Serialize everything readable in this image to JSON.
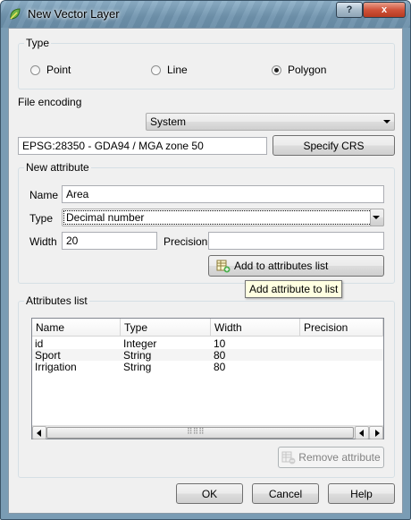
{
  "window": {
    "title": "New Vector Layer",
    "help_glyph": "?",
    "close_glyph": "x"
  },
  "type_group": {
    "title": "Type",
    "options": [
      {
        "label": "Point",
        "checked": false
      },
      {
        "label": "Line",
        "checked": false
      },
      {
        "label": "Polygon",
        "checked": true
      }
    ]
  },
  "encoding": {
    "label": "File encoding",
    "value": "System"
  },
  "crs": {
    "value": "EPSG:28350 - GDA94 / MGA zone 50",
    "button_label": "Specify CRS"
  },
  "new_attribute": {
    "title": "New attribute",
    "name_label": "Name",
    "name_value": "Area",
    "type_label": "Type",
    "type_value": "Decimal number",
    "width_label": "Width",
    "width_value": "20",
    "precision_label": "Precision",
    "precision_value": "",
    "add_button_label": "Add to attributes list",
    "tooltip": "Add attribute to list"
  },
  "attributes_list": {
    "title": "Attributes list",
    "columns": [
      "Name",
      "Type",
      "Width",
      "Precision"
    ],
    "rows": [
      [
        "id",
        "Integer",
        "10",
        ""
      ],
      [
        "Sport",
        "String",
        "80",
        ""
      ],
      [
        "Irrigation",
        "String",
        "80",
        ""
      ]
    ],
    "remove_button_label": "Remove attribute",
    "scroll_grip": "⠿⠿⠿"
  },
  "footer": {
    "ok_label": "OK",
    "cancel_label": "Cancel",
    "help_label": "Help"
  },
  "colors": {
    "titlebar": "#7a9cb4",
    "dialog_bg": "#f0f0f0",
    "tooltip_bg": "#ffffe1",
    "close_button": "#c94a30"
  }
}
